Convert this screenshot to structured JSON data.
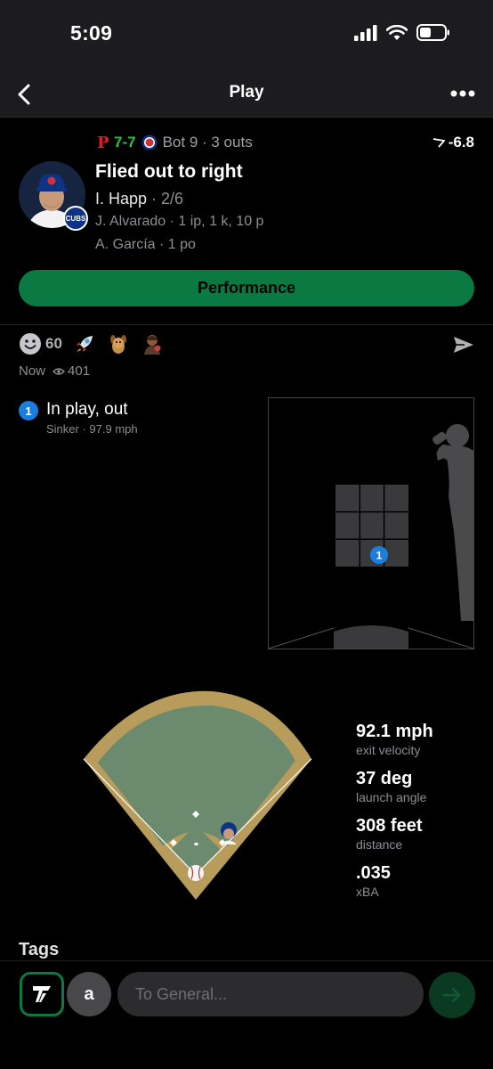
{
  "status_bar": {
    "time": "5:09"
  },
  "nav": {
    "title": "Play",
    "back_icon": "chevron-left-icon",
    "more_icon": "ellipsis-icon"
  },
  "game": {
    "score": "7-7",
    "inning": "Bot 9 · 3 outs",
    "win_prob_change": "-6.8",
    "away_team_logo": "phillies-logo",
    "home_team_logo": "cubs-logo"
  },
  "play": {
    "title": "Flied out to right",
    "batter_name": "I. Happ",
    "batter_line": " · 2/6",
    "pitcher": "J. Alvarado · 1 ip, 1 k, 10 p",
    "fielder": "A. García · 1 po",
    "team_badge": "CUBS"
  },
  "performance_button": "Performance",
  "reactions": {
    "count": "60",
    "items": [
      "smile-emoji",
      "rocket-emoji",
      "dog-emoji",
      "person-emoji"
    ]
  },
  "meta": {
    "time": "Now",
    "views": "401"
  },
  "pitch": {
    "number": "1",
    "result": "In play, out",
    "detail": "Sinker ·  97.9 mph"
  },
  "stats": [
    {
      "value": "92.1 mph",
      "label": "exit velocity"
    },
    {
      "value": "37 deg",
      "label": "launch angle"
    },
    {
      "value": "308 feet",
      "label": "distance"
    },
    {
      "value": ".035",
      "label": "xBA"
    }
  ],
  "tags_header": "Tags",
  "composer": {
    "user_initial": "a",
    "placeholder": "To General..."
  },
  "colors": {
    "accent_green": "#0a7a42",
    "score_green": "#30c050",
    "pitch_blue": "#1a7de0",
    "field_grass": "#6b8a6e",
    "field_dirt": "#b89c5c"
  }
}
